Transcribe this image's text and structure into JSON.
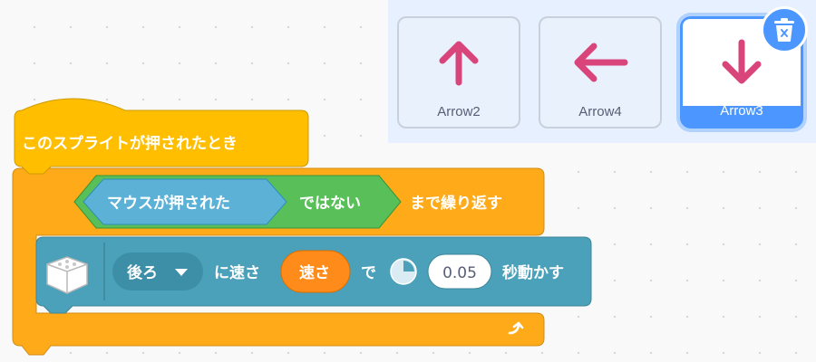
{
  "hat_block": {
    "label": "このスプライトが押されたとき"
  },
  "repeat_block": {
    "condition_label": "マウスが押された",
    "not_label": "ではない",
    "suffix_label": "まで繰り返す"
  },
  "move_block": {
    "direction_value": "後ろ",
    "speed_prefix": "に速さ",
    "speed_variable": "速さ",
    "with_label": "で",
    "seconds_value": "0.05",
    "suffix_label": "秒動かす"
  },
  "costumes": [
    {
      "name": "Arrow2",
      "icon": "arrow-up-icon",
      "selected": false
    },
    {
      "name": "Arrow4",
      "icon": "arrow-left-icon",
      "selected": false
    },
    {
      "name": "Arrow3",
      "icon": "arrow-down-icon",
      "selected": true
    }
  ],
  "colors": {
    "control": "#ffab19",
    "control_dark": "#cf8b17",
    "events": "#ffbf00",
    "operators": "#59c059",
    "sensing": "#5cb1d6",
    "extension": "#4ba1ba",
    "variable": "#ff8c1a",
    "selection": "#4c97ff",
    "arrow": "#d9457a"
  }
}
